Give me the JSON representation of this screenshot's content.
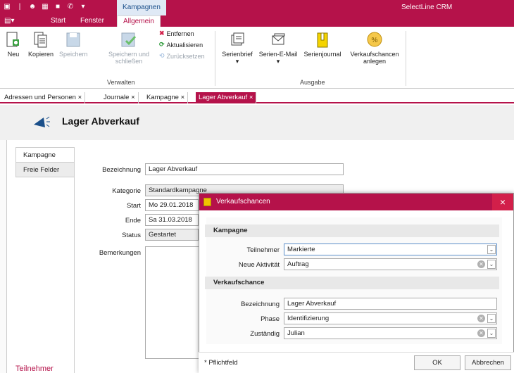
{
  "titlebar": {
    "context_tab": "Kampagnen",
    "app_title": "SelectLine CRM"
  },
  "ribbon_tabs": {
    "start": "Start",
    "fenster": "Fenster",
    "allgemein": "Allgemein"
  },
  "ribbon": {
    "neu": "Neu",
    "kopieren": "Kopieren",
    "speichern": "Speichern",
    "speichern_schliessen_1": "Speichern und",
    "speichern_schliessen_2": "schließen",
    "entfernen": "Entfernen",
    "aktualisieren": "Aktualisieren",
    "zuruecksetzen": "Zurücksetzen",
    "group_verwalten": "Verwalten",
    "serienbrief": "Serienbrief",
    "serien_email": "Serien-E-Mail",
    "serienjournal": "Serienjournal",
    "verkaufschancen_1": "Verkaufschancen",
    "verkaufschancen_2": "anlegen",
    "group_ausgabe": "Ausgabe"
  },
  "doc_tabs": [
    {
      "label": "Adressen und Personen",
      "close": "×"
    },
    {
      "label": "Journale",
      "close": "×"
    },
    {
      "label": "Kampagne",
      "close": "×"
    },
    {
      "label": "Lager Abverkauf",
      "close": "×"
    }
  ],
  "page": {
    "title": "Lager Abverkauf",
    "nav": [
      "Kampagne",
      "Freie Felder"
    ],
    "teilnehmer_heading": "Teilnehmer"
  },
  "form": {
    "bezeichnung_label": "Bezeichnung",
    "bezeichnung_value": "Lager Abverkauf",
    "kategorie_label": "Kategorie",
    "kategorie_value": "Standardkampagne",
    "start_label": "Start",
    "start_value": "Mo 29.01.2018",
    "ende_label": "Ende",
    "ende_value": "Sa 31.03.2018",
    "status_label": "Status",
    "status_value": "Gestartet",
    "bemerkungen_label": "Bemerkungen"
  },
  "dialog": {
    "title": "Verkaufschancen",
    "close": "×",
    "section_kampagne": "Kampagne",
    "teilnehmer_label": "Teilnehmer",
    "teilnehmer_value": "Markierte",
    "neue_aktivitaet_label": "Neue Aktivität",
    "neue_aktivitaet_value": "Auftrag",
    "section_verkaufschance": "Verkaufschance",
    "bezeichnung_label": "Bezeichnung",
    "bezeichnung_value": "Lager Abverkauf",
    "phase_label": "Phase",
    "phase_value": "Identifizierung",
    "zustaendig_label": "Zuständig",
    "zustaendig_value": "Julian",
    "footer_note": "* Pflichtfeld",
    "ok": "OK",
    "cancel": "Abbrechen"
  },
  "colors": {
    "brand": "#b5124a",
    "close_red": "#d21f4a"
  },
  "icons": {
    "dropdown": "⌄",
    "clear": "⊗"
  }
}
